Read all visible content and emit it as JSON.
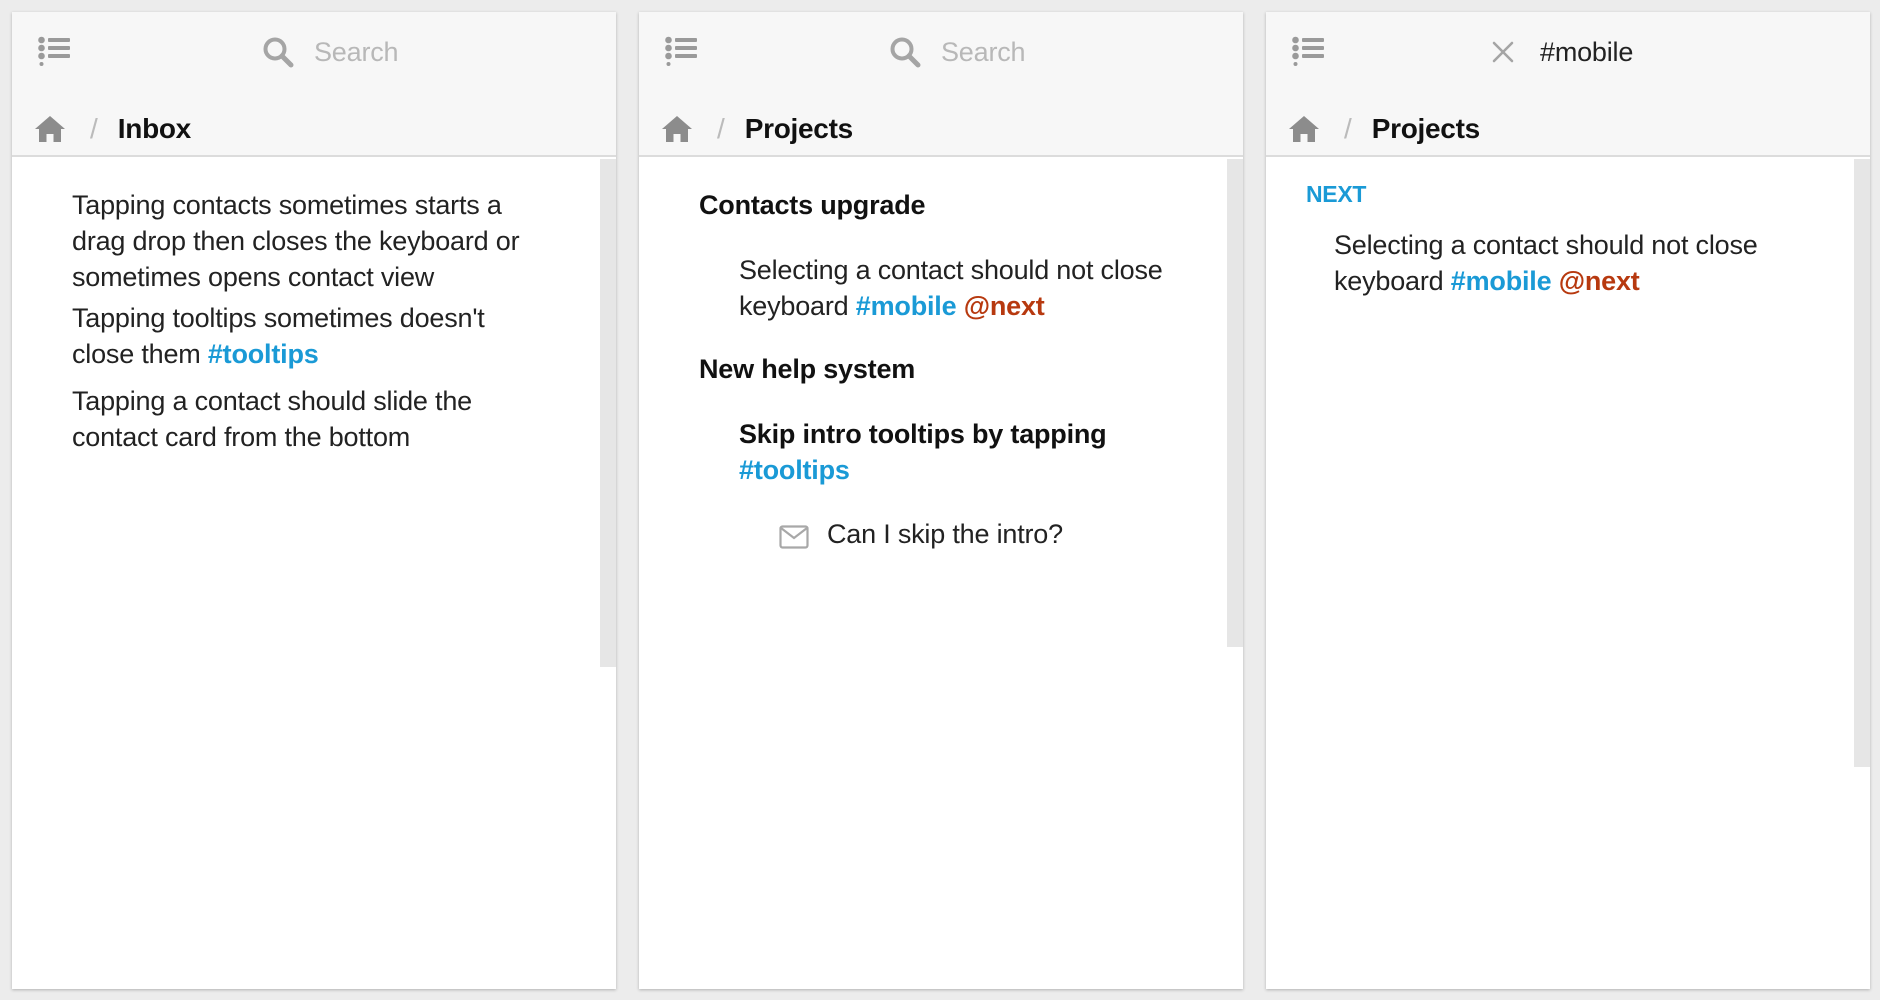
{
  "colors": {
    "tag_blue": "#1a9ad6",
    "tag_red": "#b7390f",
    "icon_gray": "#9a9a9a"
  },
  "panels": [
    {
      "search": {
        "placeholder": "Search"
      },
      "breadcrumb": {
        "home_icon": "home-icon",
        "separator": "/",
        "title": "Inbox"
      },
      "items": [
        {
          "lines": [
            "Tapping contacts sometimes starts a",
            "drag drop then closes the keyboard or",
            "sometimes opens contact view"
          ]
        },
        {
          "lines": [
            "Tapping tooltips sometimes doesn't"
          ],
          "last_line_text": "close them ",
          "tag": "#tooltips"
        },
        {
          "lines": [
            "Tapping a contact should slide the",
            "contact card from the bottom"
          ]
        }
      ]
    },
    {
      "search": {
        "placeholder": "Search"
      },
      "breadcrumb": {
        "home_icon": "home-icon",
        "separator": "/",
        "title": "Projects"
      },
      "project_1": {
        "title": "Contacts upgrade",
        "task_line1": "Selecting a contact should not close",
        "task_line2": "keyboard ",
        "tag": "#mobile",
        "mention": "@next"
      },
      "project_2": {
        "title": "New help system",
        "task_title": "Skip intro tooltips by tapping",
        "task_tag": "#tooltips",
        "note_icon": "mail-icon",
        "note": "Can I skip the intro?"
      }
    },
    {
      "search": {
        "query": "#mobile",
        "clear_icon": "close-icon"
      },
      "breadcrumb": {
        "home_icon": "home-icon",
        "separator": "/",
        "title": "Projects"
      },
      "section": "NEXT",
      "task_line1": "Selecting a contact should not close",
      "task_line2": "keyboard ",
      "tag": "#mobile",
      "mention": "@next"
    }
  ]
}
